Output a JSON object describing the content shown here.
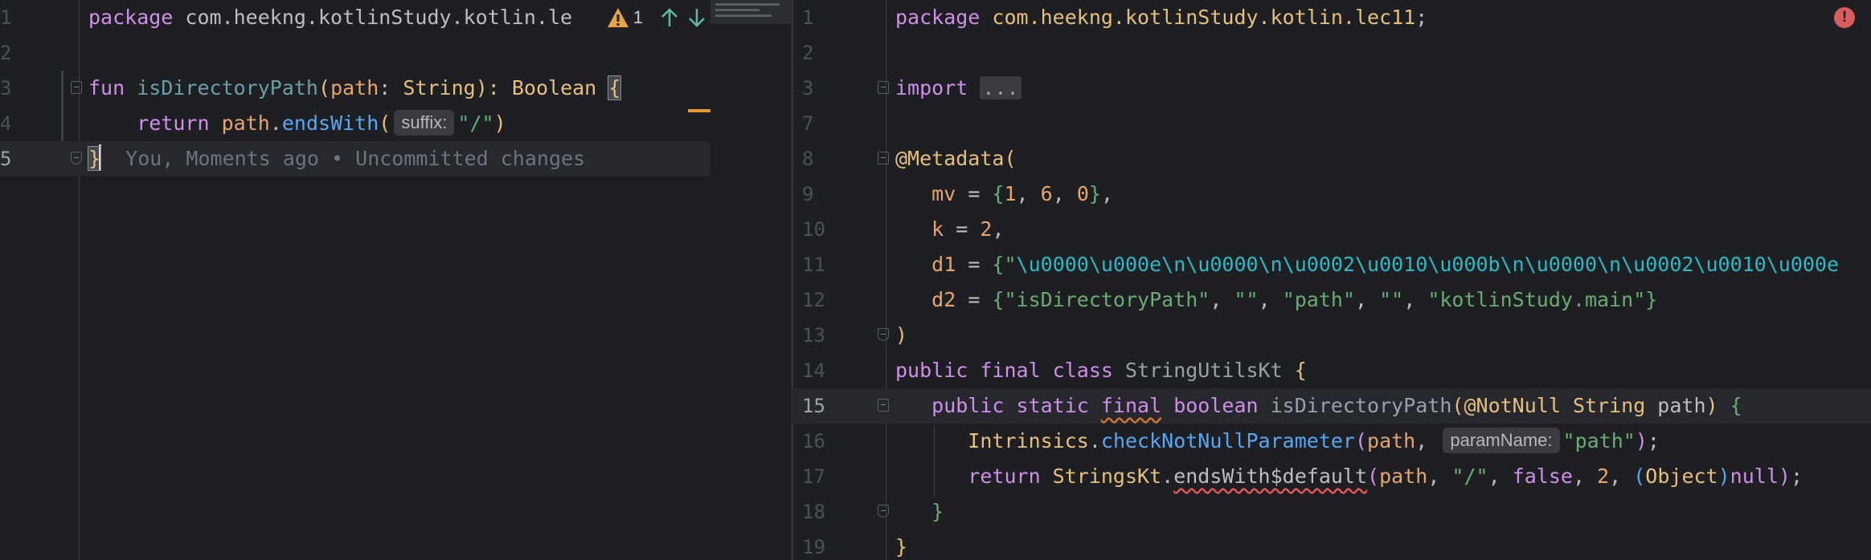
{
  "left_editor": {
    "toolbar": {
      "warning_count": "1"
    },
    "lines": [
      {
        "num": "1",
        "tokens": [
          {
            "t": "package ",
            "c": "kw"
          },
          {
            "t": "com.heekng.kotlinStudy.kotlin.le",
            "c": ""
          }
        ]
      },
      {
        "num": "2",
        "tokens": []
      },
      {
        "num": "3",
        "tokens": [
          {
            "t": "fun ",
            "c": "kw"
          },
          {
            "t": "isDirectoryPath",
            "c": "fnd"
          },
          {
            "t": "(",
            "c": "br1"
          },
          {
            "t": "path",
            "c": "pm"
          },
          {
            "t": ": ",
            "c": ""
          },
          {
            "t": "String",
            "c": "ty"
          },
          {
            "t": "): ",
            "c": "br1"
          },
          {
            "t": "Boolean ",
            "c": "ty"
          }
        ]
      },
      {
        "num": "4",
        "tokens": [
          {
            "t": "    return ",
            "c": "kw"
          },
          {
            "t": "path",
            "c": "pm"
          },
          {
            "t": ".",
            "c": ""
          },
          {
            "t": "endsWith",
            "c": "fn"
          },
          {
            "t": "(",
            "c": "br1"
          }
        ]
      },
      {
        "num": "5",
        "tokens": []
      }
    ],
    "line3_brace": "{",
    "line4_hint": "suffix:",
    "line4_tail_str": "\"/\"",
    "line4_tail_paren": ")",
    "line5_brace": "}",
    "blame": "  You, Moments ago • Uncommitted changes"
  },
  "right_editor": {
    "lines": [
      {
        "num": "1",
        "tokens": [
          {
            "t": "package ",
            "c": "kw"
          },
          {
            "t": "com.heekng.kotlinStudy.kotlin.lec11",
            "c": "ty"
          },
          {
            "t": ";",
            "c": ""
          }
        ]
      },
      {
        "num": "2",
        "tokens": []
      },
      {
        "num": "3",
        "tokens": [
          {
            "t": "import ",
            "c": "kw"
          },
          {
            "t": "...",
            "c": "fold-coll"
          }
        ]
      },
      {
        "num": "7",
        "tokens": []
      },
      {
        "num": "8",
        "tokens": [
          {
            "t": "@Metadata",
            "c": "ann"
          },
          {
            "t": "(",
            "c": "br1"
          }
        ]
      },
      {
        "num": "9",
        "tokens": [
          {
            "t": "   mv",
            "c": "pm"
          },
          {
            "t": " = ",
            "c": ""
          },
          {
            "t": "{",
            "c": "grn"
          },
          {
            "t": "1",
            "c": "num"
          },
          {
            "t": ", ",
            "c": ""
          },
          {
            "t": "6",
            "c": "num"
          },
          {
            "t": ", ",
            "c": ""
          },
          {
            "t": "0",
            "c": "num"
          },
          {
            "t": "}",
            "c": "grn"
          },
          {
            "t": ",",
            "c": ""
          }
        ]
      },
      {
        "num": "10",
        "tokens": [
          {
            "t": "   k",
            "c": "pm"
          },
          {
            "t": " = ",
            "c": ""
          },
          {
            "t": "2",
            "c": "num"
          },
          {
            "t": ",",
            "c": ""
          }
        ]
      },
      {
        "num": "11",
        "tokens": [
          {
            "t": "   d1",
            "c": "pm"
          },
          {
            "t": " = ",
            "c": ""
          },
          {
            "t": "{",
            "c": "grn"
          },
          {
            "t": "\"",
            "c": "st"
          },
          {
            "t": "\\u0000\\u000e\\n\\u0000\\n\\u0002\\u0010\\u000b\\n\\u0000\\n\\u0002\\u0010\\u000e",
            "c": "esc"
          }
        ]
      },
      {
        "num": "12",
        "tokens": [
          {
            "t": "   d2",
            "c": "pm"
          },
          {
            "t": " = ",
            "c": ""
          },
          {
            "t": "{",
            "c": "grn"
          },
          {
            "t": "\"isDirectoryPath\"",
            "c": "st"
          },
          {
            "t": ", ",
            "c": ""
          },
          {
            "t": "\"\"",
            "c": "st"
          },
          {
            "t": ", ",
            "c": ""
          },
          {
            "t": "\"path\"",
            "c": "st"
          },
          {
            "t": ", ",
            "c": ""
          },
          {
            "t": "\"\"",
            "c": "st"
          },
          {
            "t": ", ",
            "c": ""
          },
          {
            "t": "\"kotlinStudy.main\"",
            "c": "st"
          },
          {
            "t": "}",
            "c": "grn"
          }
        ]
      },
      {
        "num": "13",
        "tokens": [
          {
            "t": ")",
            "c": "br1"
          }
        ]
      },
      {
        "num": "14",
        "tokens": [
          {
            "t": "public ",
            "c": "kw"
          },
          {
            "t": "final ",
            "c": "kw"
          },
          {
            "t": "class ",
            "c": "kw"
          },
          {
            "t": "StringUtilsKt ",
            "c": "cls"
          },
          {
            "t": "{",
            "c": "br1"
          }
        ]
      },
      {
        "num": "15",
        "tokens": [
          {
            "t": "   public ",
            "c": "kw"
          },
          {
            "t": "static ",
            "c": "kw"
          },
          {
            "t": "final",
            "c": "kw wavy-o"
          },
          {
            "t": " ",
            "c": ""
          },
          {
            "t": "boolean ",
            "c": "kw"
          },
          {
            "t": "isDirectoryPath",
            "c": "cls"
          },
          {
            "t": "(",
            "c": "br1"
          },
          {
            "t": "@NotNull ",
            "c": "ann"
          },
          {
            "t": "String ",
            "c": "ty"
          },
          {
            "t": "path",
            "c": ""
          },
          {
            "t": ") ",
            "c": "br1"
          },
          {
            "t": "{",
            "c": "grn"
          }
        ]
      },
      {
        "num": "16",
        "tokens": [
          {
            "t": "      Intrinsics",
            "c": "ty"
          },
          {
            "t": ".",
            "c": ""
          },
          {
            "t": "checkNotNullParameter",
            "c": "fn"
          },
          {
            "t": "(",
            "c": "br2"
          },
          {
            "t": "path",
            "c": "pm"
          },
          {
            "t": ", ",
            "c": ""
          }
        ]
      },
      {
        "num": "17",
        "tokens": [
          {
            "t": "      return ",
            "c": "kw"
          },
          {
            "t": "StringsKt",
            "c": "ty"
          },
          {
            "t": ".",
            "c": ""
          },
          {
            "t": "endsWith$default",
            "c": "wavy"
          },
          {
            "t": "(",
            "c": "br2"
          },
          {
            "t": "path",
            "c": "pm"
          },
          {
            "t": ", ",
            "c": ""
          },
          {
            "t": "\"/\"",
            "c": "st"
          },
          {
            "t": ", ",
            "c": ""
          },
          {
            "t": "false",
            "c": "kw"
          },
          {
            "t": ", ",
            "c": ""
          },
          {
            "t": "2",
            "c": "num"
          },
          {
            "t": ", ",
            "c": ""
          },
          {
            "t": "(",
            "c": "br3"
          },
          {
            "t": "Object",
            "c": "ty"
          },
          {
            "t": ")",
            "c": "br3"
          },
          {
            "t": "null",
            "c": "kw"
          },
          {
            "t": ")",
            "c": "br2"
          },
          {
            "t": ";",
            "c": ""
          }
        ]
      },
      {
        "num": "18",
        "tokens": [
          {
            "t": "   }",
            "c": "grn"
          }
        ]
      },
      {
        "num": "19",
        "tokens": [
          {
            "t": "}",
            "c": "br1"
          }
        ]
      }
    ],
    "line16_hint": "paramName:",
    "line16_tail": "\"path\"",
    "line16_end": ")",
    "line16_semi": ";",
    "error_glyph": "!"
  }
}
